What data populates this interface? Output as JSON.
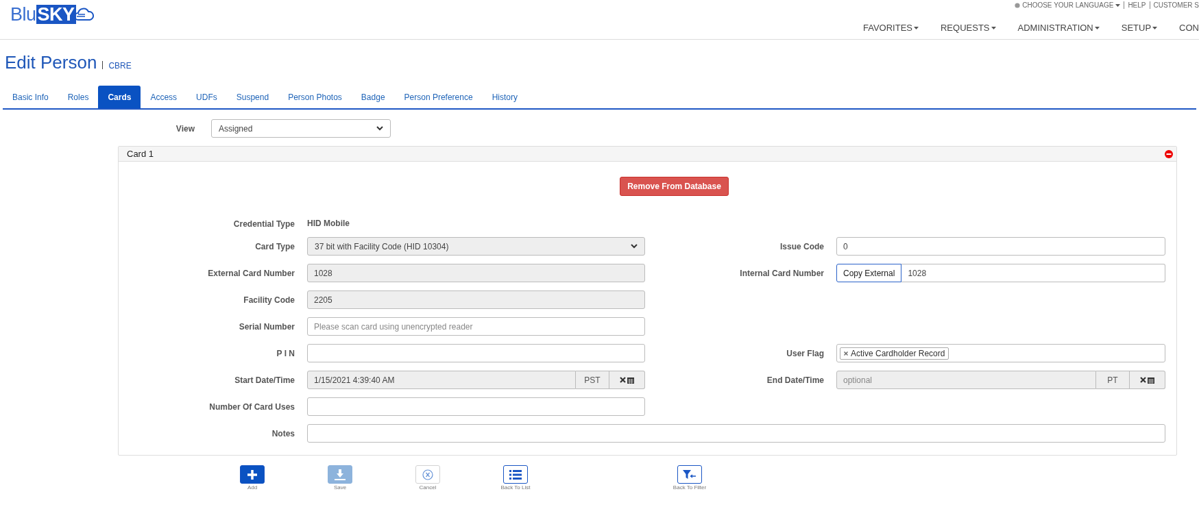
{
  "header": {
    "logo": {
      "prefix": "Blu",
      "highlight": "SKY"
    },
    "top_links": [
      {
        "label": "CHOOSE YOUR LANGUAGE",
        "dropdown": true
      },
      {
        "label": "HELP",
        "dropdown": false
      },
      {
        "label": "CUSTOMER S",
        "dropdown": false
      }
    ],
    "nav": [
      {
        "label": "FAVORITES",
        "dropdown": true
      },
      {
        "label": "REQUESTS",
        "dropdown": true
      },
      {
        "label": "ADMINISTRATION",
        "dropdown": true
      },
      {
        "label": "SETUP",
        "dropdown": true
      },
      {
        "label": "CON",
        "dropdown": false
      }
    ]
  },
  "page": {
    "title": "Edit Person",
    "subtitle": "CBRE"
  },
  "tabs": [
    {
      "label": "Basic Info",
      "selected": false
    },
    {
      "label": "Roles",
      "selected": false
    },
    {
      "label": "Cards",
      "selected": true
    },
    {
      "label": "Access",
      "selected": false
    },
    {
      "label": "UDFs",
      "selected": false
    },
    {
      "label": "Suspend",
      "selected": false
    },
    {
      "label": "Person Photos",
      "selected": false
    },
    {
      "label": "Badge",
      "selected": false
    },
    {
      "label": "Person Preference",
      "selected": false
    },
    {
      "label": "History",
      "selected": false
    }
  ],
  "view": {
    "label": "View",
    "value": "Assigned"
  },
  "card": {
    "title": "Card 1",
    "remove_button": "Remove From Database",
    "rows": [
      {
        "left": {
          "label": "Credential Type",
          "kind": "text",
          "value": "HID Mobile"
        }
      },
      {
        "left": {
          "label": "Card Type",
          "kind": "select",
          "value": "37 bit with Facility Code (HID 10304)",
          "disabled": true
        },
        "right": {
          "label": "Issue Code",
          "kind": "input",
          "value": "0",
          "disabled": false
        }
      },
      {
        "left": {
          "label": "External Card Number",
          "kind": "input",
          "value": "1028",
          "disabled": true
        },
        "right": {
          "label": "Internal Card Number",
          "kind": "copy",
          "button": "Copy External",
          "value": "1028",
          "disabled": false
        }
      },
      {
        "left": {
          "label": "Facility Code",
          "kind": "input",
          "value": "2205",
          "disabled": true
        }
      },
      {
        "left": {
          "label": "Serial Number",
          "kind": "input",
          "placeholder": "Please scan card using unencrypted reader",
          "disabled": false
        }
      },
      {
        "left": {
          "label": "P I N",
          "kind": "input",
          "disabled": false
        },
        "right": {
          "label": "User Flag",
          "kind": "tags",
          "tags": [
            "Active Cardholder Record"
          ]
        }
      },
      {
        "left": {
          "label": "Start Date/Time",
          "kind": "datetime",
          "value": "1/15/2021 4:39:40 AM",
          "zone": "PST",
          "disabled": true
        },
        "right": {
          "label": "End Date/Time",
          "kind": "datetime",
          "placeholder": "optional",
          "zone": "PT",
          "disabled": true
        }
      },
      {
        "left": {
          "label": "Number Of Card Uses",
          "kind": "input",
          "disabled": false
        }
      }
    ],
    "notes": {
      "label": "Notes",
      "disabled": false
    }
  },
  "actions": [
    {
      "label": "Add",
      "kind": "add",
      "disabled": false
    },
    {
      "label": "Save",
      "kind": "save",
      "disabled": true
    },
    {
      "label": "Cancel",
      "kind": "cancel",
      "disabled": true
    },
    {
      "label": "Back To List",
      "kind": "list",
      "disabled": false
    },
    {
      "label": "Back To Filter",
      "kind": "filter",
      "disabled": false
    }
  ]
}
